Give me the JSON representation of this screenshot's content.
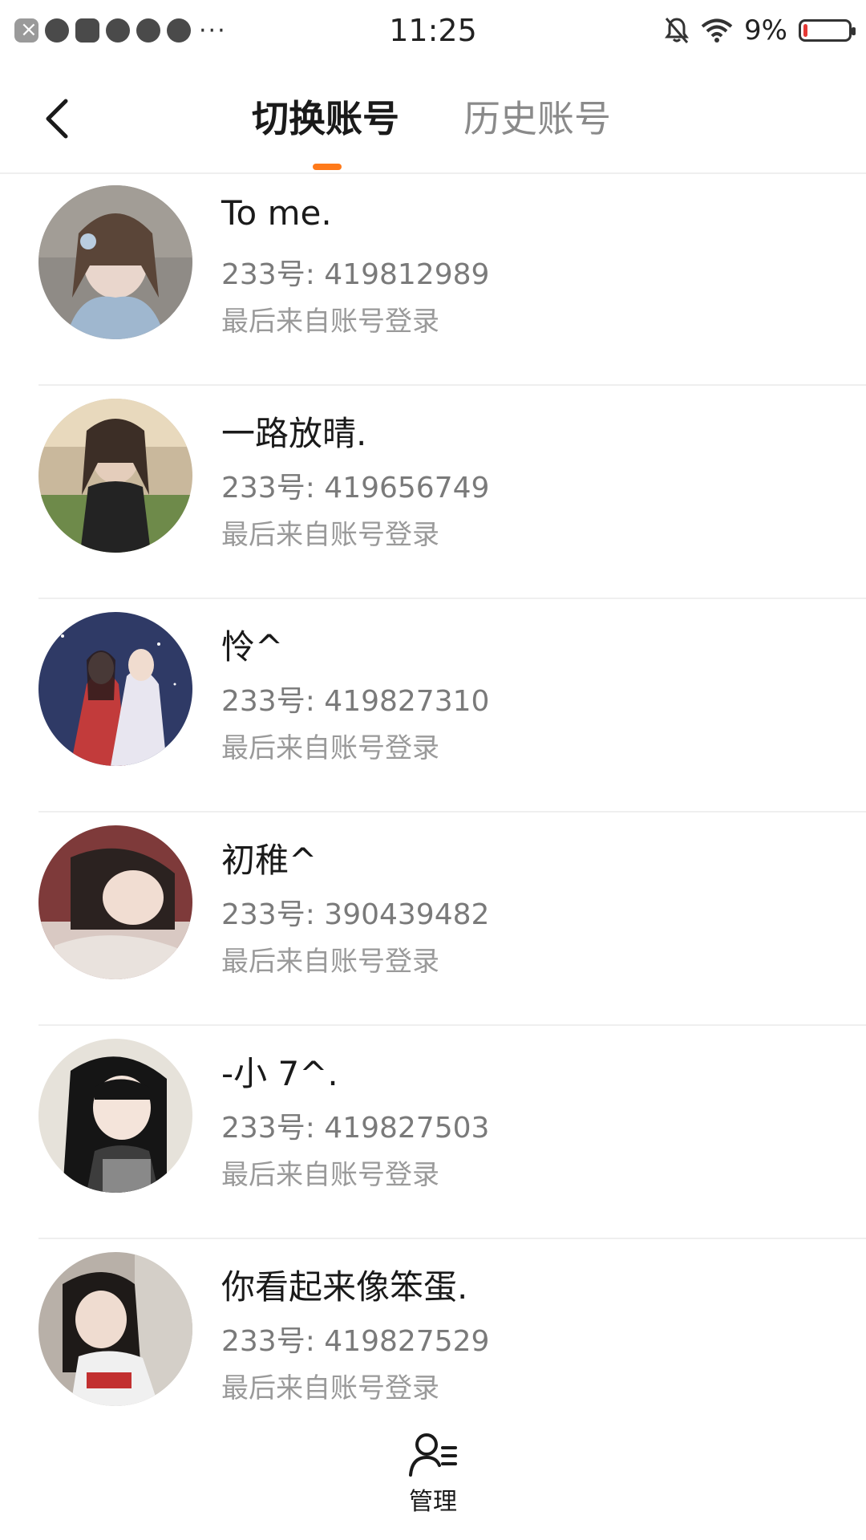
{
  "status_bar": {
    "time": "11:25",
    "battery_percent": "9%",
    "battery_level": 0.09,
    "left_icons": [
      "close-notification-icon",
      "cloud-icon",
      "mail-icon",
      "pinwheel-icon",
      "video-icon",
      "planet-icon"
    ],
    "more": "···"
  },
  "nav": {
    "tab_switch": "切换账号",
    "tab_history": "历史账号"
  },
  "accounts": [
    {
      "name": "To me.",
      "id_line": "233号: 419812989",
      "source": "最后来自账号登录"
    },
    {
      "name": "一路放晴.",
      "id_line": "233号: 419656749",
      "source": "最后来自账号登录"
    },
    {
      "name": "怜^",
      "id_line": "233号: 419827310",
      "source": "最后来自账号登录"
    },
    {
      "name": "初稚^",
      "id_line": "233号: 390439482",
      "source": "最后来自账号登录"
    },
    {
      "name": "-小 7^.",
      "id_line": "233号: 419827503",
      "source": "最后来自账号登录"
    },
    {
      "name": "你看起来像笨蛋.",
      "id_line": "233号: 419827529",
      "source": "最后来自账号登录"
    }
  ],
  "bottom": {
    "manage_label": "管理"
  },
  "colors": {
    "accent": "#ff7a1a",
    "battery_low": "#e53935"
  }
}
